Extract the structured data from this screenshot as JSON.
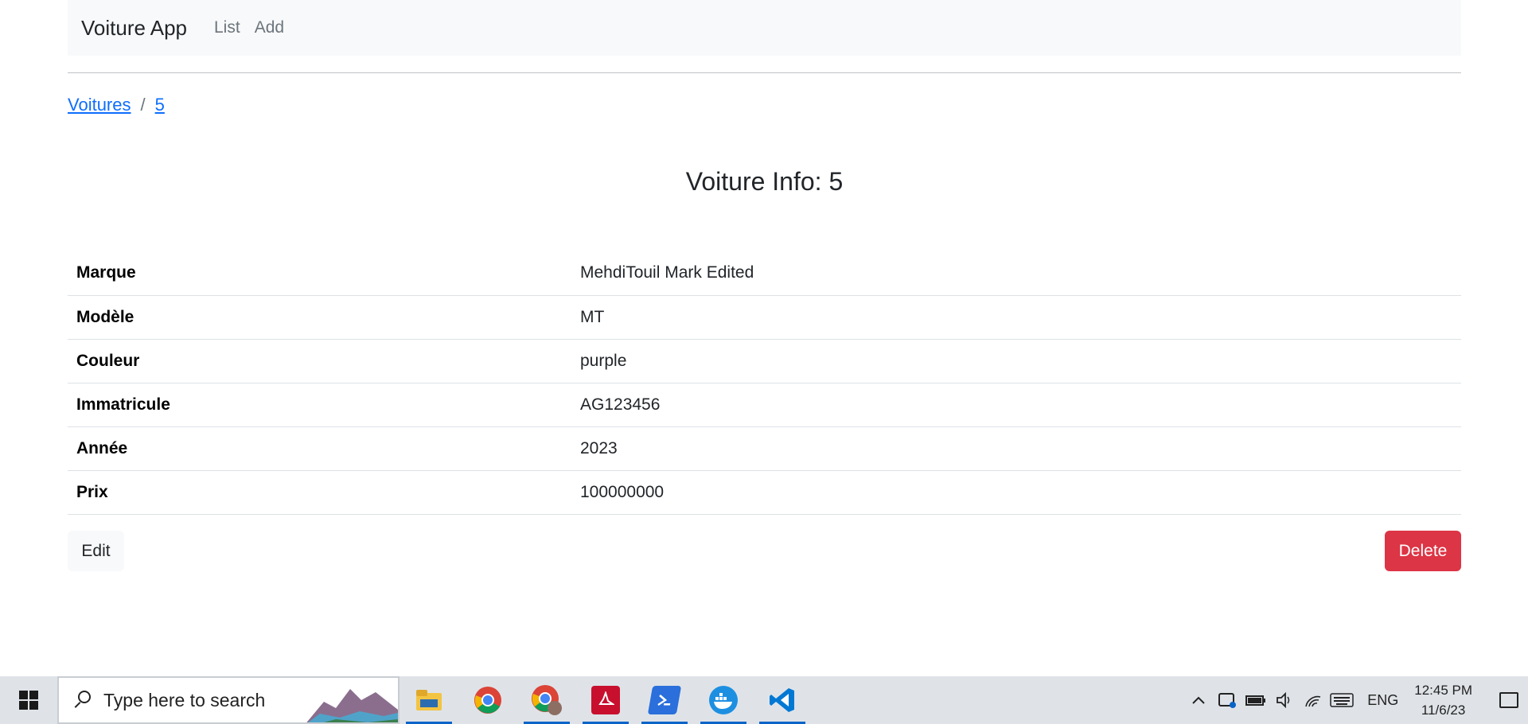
{
  "navbar": {
    "brand": "Voiture App",
    "links": [
      "List",
      "Add"
    ]
  },
  "breadcrumb": {
    "items": [
      "Voitures",
      "5"
    ],
    "separator": "/"
  },
  "title": "Voiture Info: 5",
  "details": [
    {
      "label": "Marque",
      "value": "MehdiTouil Mark Edited"
    },
    {
      "label": "Modèle",
      "value": "MT"
    },
    {
      "label": "Couleur",
      "value": "purple"
    },
    {
      "label": "Immatricule",
      "value": "AG123456"
    },
    {
      "label": "Année",
      "value": "2023"
    },
    {
      "label": "Prix",
      "value": "100000000"
    }
  ],
  "actions": {
    "edit": "Edit",
    "delete": "Delete"
  },
  "colors": {
    "primary_link": "#0d6efd",
    "danger": "#dc3545",
    "navbar_bg": "#f8f9fa"
  },
  "taskbar": {
    "search_placeholder": "Type here to search",
    "apps": [
      "file-explorer-icon",
      "chrome-icon",
      "chrome-profile-icon",
      "acrobat-icon",
      "powershell-icon",
      "docker-icon",
      "vscode-icon"
    ],
    "language": "ENG",
    "time": "12:45 PM",
    "date": "11/6/23"
  }
}
